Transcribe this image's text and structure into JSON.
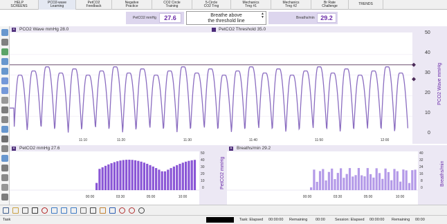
{
  "top_tabs": [
    {
      "line1": "HELP",
      "line2": "SCREENS",
      "active": false
    },
    {
      "line1": "PCO2-wave",
      "line2": "Learning",
      "active": true
    },
    {
      "line1": "PetCO2",
      "line2": "Feedback",
      "active": false
    },
    {
      "line1": "Negative",
      "line2": "Practice",
      "active": false
    },
    {
      "line1": "CO2 Circle",
      "line2": "Training",
      "active": false
    },
    {
      "line1": "5-Circle",
      "line2": "CO2 Trng",
      "active": false
    },
    {
      "line1": "Mechanics",
      "line2": "Trng #1",
      "active": false
    },
    {
      "line1": "Mechanics",
      "line2": "Trng #2",
      "active": false
    },
    {
      "line1": "Br Rate",
      "line2": "Challenge",
      "active": false
    },
    {
      "line1": "TRENDS",
      "line2": "",
      "active": false
    }
  ],
  "readouts": {
    "petco2_label": "PetCO2 mmHg",
    "petco2_value": "27.6",
    "message_line1": "Breathe above",
    "message_line2": "the threshold line",
    "breaths_label": "Breaths/min",
    "breaths_value": "29.2"
  },
  "wave_panel": {
    "left_title": "PCO2 Wave mmHg 28.0",
    "threshold_title": "PetCO2 Threshold 35.0",
    "side_title": "PCO2 Wave mmHg",
    "y_ticks": [
      "50",
      "40",
      "30",
      "20",
      "10",
      "0"
    ],
    "x_ticks": [
      "11:10",
      "11:20",
      "11:30",
      "11:40",
      "11:50",
      "12:00"
    ]
  },
  "petco2_panel": {
    "title": "PetCO2 mmHg 27.6",
    "side_title": "PetCO2 mmHg",
    "y_ticks": [
      "50",
      "40",
      "30",
      "20",
      "10",
      "0"
    ],
    "x_ticks": [
      "00:00",
      "03:30",
      "05:00",
      "10:00"
    ]
  },
  "breaths_panel": {
    "title": "Breaths/min 29.2",
    "side_title": "Breaths/min",
    "y_ticks": [
      "40",
      "32",
      "24",
      "16",
      "8",
      "0"
    ],
    "x_ticks": [
      "00:00",
      "03:30",
      "05:00",
      "10:00"
    ]
  },
  "status": {
    "task": "Task",
    "task_elapsed": "Task: Elapsed",
    "task_elapsed_time": "00:00:00",
    "remaining1": "Remaining",
    "remaining1_time": "00:00",
    "session_elapsed": "Session: Elapsed",
    "session_elapsed_time": "00:00:00",
    "remaining2": "Remaining",
    "remaining2_time": "00:00"
  },
  "icons": {
    "left": [
      "hand-icon",
      "save-icon",
      "grid-icon",
      "zoom-in-icon",
      "zoom-out-icon",
      "arrows-horizontal-icon",
      "arrows-vertical-icon",
      "wave-icon",
      "settings-icon",
      "list-icon",
      "bar-icon",
      "pulse-icon",
      "scroll-icon",
      "trend-icon",
      "speaker-icon",
      "table-icon",
      "layout-icon",
      "monitor-icon"
    ],
    "bottom": [
      "pointer-icon",
      "folder-icon",
      "print-icon",
      "stop-icon",
      "record-icon",
      "media-icon",
      "screen-icon",
      "image-icon",
      "clipboard-icon",
      "camera-icon",
      "hand-icon",
      "help-icon",
      "mute-icon",
      "target-icon",
      "circle-icon"
    ]
  },
  "colors": {
    "wave": "#8a6cc0",
    "threshold": "#6a4e6e",
    "bar": "#8a56d6",
    "bar_light": "#b49ae8",
    "panel_head": "#ece8f4",
    "accent": "#6a2aa8"
  }
}
